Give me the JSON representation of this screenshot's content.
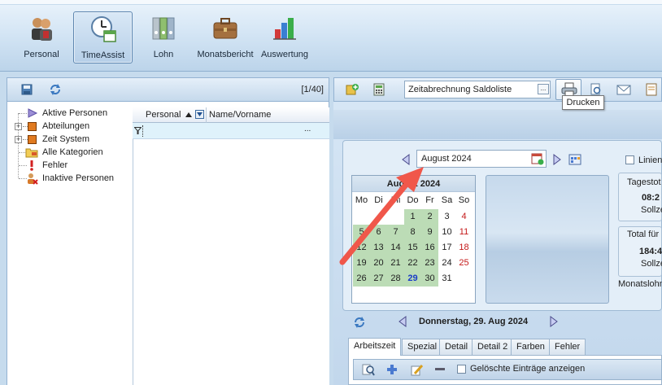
{
  "ribbon": {
    "items": [
      {
        "label": "Personal",
        "icon": "people-icon"
      },
      {
        "label": "TimeAssist",
        "icon": "clock-calendar-icon",
        "selected": true
      },
      {
        "label": "Lohn",
        "icon": "binders-icon"
      },
      {
        "label": "Monatsbericht",
        "icon": "briefcase-icon"
      },
      {
        "label": "Auswertung",
        "icon": "bar-chart-icon"
      }
    ]
  },
  "left": {
    "record_counter": "[1/40]",
    "tree": [
      {
        "label": "Aktive Personen",
        "icon": "arrow-right-icon"
      },
      {
        "label": "Abteilungen",
        "icon": "orange-square-icon",
        "expandable": true
      },
      {
        "label": "Zeit System",
        "icon": "orange-square-icon",
        "expandable": true
      },
      {
        "label": "Alle Kategorien",
        "icon": "folder-tag-icon"
      },
      {
        "label": "Fehler",
        "icon": "exclamation-icon"
      },
      {
        "label": "Inaktive Personen",
        "icon": "person-remove-icon"
      }
    ],
    "grid": {
      "columns": [
        "Personal",
        "Name/Vorname"
      ],
      "filter_ellipsis": "..."
    }
  },
  "right": {
    "report_combo": "Zeitabrechnung Saldoliste",
    "combo_button": "...",
    "tooltip": "Drucken",
    "month": "August 2024",
    "calendar": {
      "title": "August 2024",
      "weekdays": [
        "Mo",
        "Di",
        "Mi",
        "Do",
        "Fr",
        "Sa",
        "So"
      ],
      "weeks": [
        [
          "",
          "",
          "",
          "1",
          "2",
          "3",
          "4"
        ],
        [
          "5",
          "6",
          "7",
          "8",
          "9",
          "10",
          "11"
        ],
        [
          "12",
          "13",
          "14",
          "15",
          "16",
          "17",
          "18"
        ],
        [
          "19",
          "20",
          "21",
          "22",
          "23",
          "24",
          "25"
        ],
        [
          "26",
          "27",
          "28",
          "29",
          "30",
          "31",
          ""
        ]
      ],
      "today": "29"
    },
    "side": {
      "checkbox_label": "Linien",
      "box1_title": "Tagestot",
      "box1_value": "08:2",
      "box1_sub": "Sollze",
      "box2_title": "Total für",
      "box2_value": "184:4",
      "box2_sub": "Sollze",
      "monats_label": "Monatslohn"
    },
    "current_date": "Donnerstag, 29. Aug 2024",
    "tabs": [
      "Arbeitszeit",
      "Spezial",
      "Detail",
      "Detail 2",
      "Farben",
      "Fehler"
    ],
    "deleted_entries_label": "Gelöschte Einträge anzeigen"
  },
  "colors": {
    "annotation_arrow": "#f0574a",
    "calendar_workday": "#bcdcb6",
    "weekend_red": "#c41818",
    "today_blue": "#1a3cc7"
  }
}
